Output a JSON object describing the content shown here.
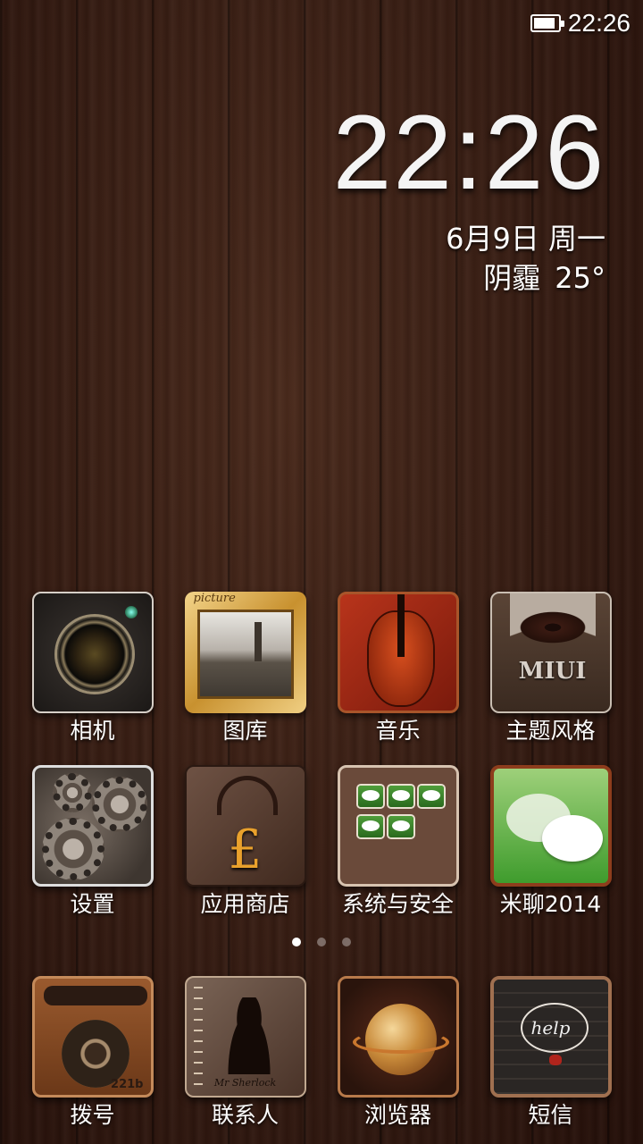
{
  "status_bar": {
    "time": "22:26",
    "battery_level": 0.9
  },
  "clock": {
    "time": "22:26",
    "date": "6月9日 周一",
    "weather": "阴霾",
    "temperature": "25°"
  },
  "row1": [
    {
      "label": "相机",
      "icon": "camera-icon"
    },
    {
      "label": "图库",
      "icon": "gallery-icon",
      "picture_text": "picture"
    },
    {
      "label": "音乐",
      "icon": "music-icon"
    },
    {
      "label": "主题风格",
      "icon": "theme-icon",
      "badge_text": "MIUI"
    }
  ],
  "row2": [
    {
      "label": "设置",
      "icon": "settings-icon"
    },
    {
      "label": "应用商店",
      "icon": "app-store-icon",
      "symbol": "£"
    },
    {
      "label": "系统与安全",
      "icon": "security-icon"
    },
    {
      "label": "米聊2014",
      "icon": "chat-icon"
    }
  ],
  "dock": [
    {
      "label": "拨号",
      "icon": "dialer-icon",
      "number": "221b"
    },
    {
      "label": "联系人",
      "icon": "contacts-icon",
      "signature": "Mr Sherlock"
    },
    {
      "label": "浏览器",
      "icon": "browser-icon"
    },
    {
      "label": "短信",
      "icon": "sms-icon",
      "note": "help"
    }
  ],
  "pages": {
    "count": 3,
    "current": 1
  }
}
